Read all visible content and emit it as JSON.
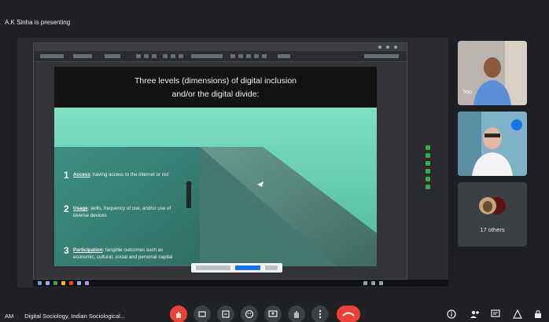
{
  "presenter_banner": "A.K Sinha is presenting",
  "slide": {
    "title": "Three levels (dimensions) of digital inclusion\nand/or the digital divide:",
    "items": [
      {
        "num": "1",
        "term": "Access",
        "text": ": having access to the internet or not"
      },
      {
        "num": "2",
        "term": "Usage",
        "text": ": skills, frequency of use, and/or use of diverse devices"
      },
      {
        "num": "3",
        "term": "Participation",
        "text": ": tangible outcomes such as economic, cultural, social and personal capital"
      }
    ]
  },
  "participants": {
    "self_label": "You",
    "others_count": "17 others"
  },
  "meeting": {
    "time": "AM",
    "name": "Digital Sociology, Indian Sociological..."
  },
  "controls": [
    "hand-icon",
    "captions-icon",
    "present-icon",
    "emoji-icon",
    "screen-share-icon",
    "raise-hand-icon",
    "more-icon",
    "end-call-icon"
  ],
  "right_tools": [
    "info-icon",
    "people-icon",
    "chat-icon",
    "activities-icon",
    "lock-icon"
  ],
  "colors": {
    "accent": "#1a73e8",
    "end_call": "#ea4335",
    "slide_teal": "#5fc6a8"
  }
}
